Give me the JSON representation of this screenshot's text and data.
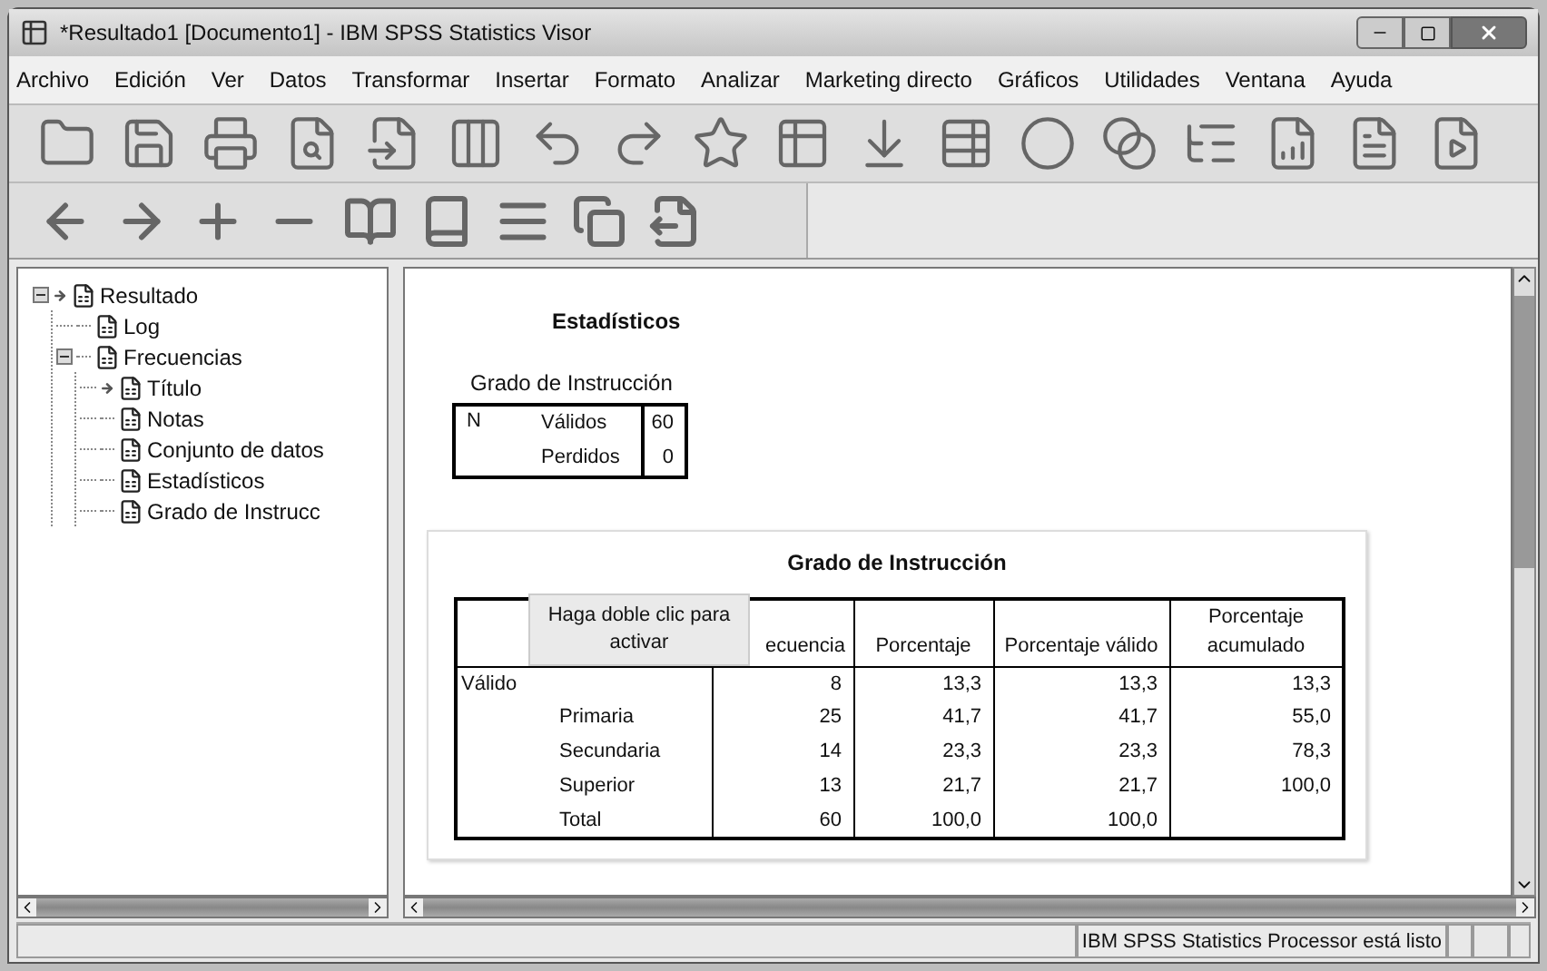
{
  "window": {
    "title": "*Resultado1 [Documento1] - IBM SPSS Statistics Visor"
  },
  "menu": [
    "Archivo",
    "Edición",
    "Ver",
    "Datos",
    "Transformar",
    "Insertar",
    "Formato",
    "Analizar",
    "Marketing directo",
    "Gráficos",
    "Utilidades",
    "Ventana",
    "Ayuda"
  ],
  "outline": [
    {
      "label": "Resultado",
      "expanded": true,
      "current": true,
      "children": [
        {
          "label": "Log",
          "current": false
        },
        {
          "label": "Frecuencias",
          "expanded": true,
          "current": false,
          "children": [
            {
              "label": "Título",
              "current": true
            },
            {
              "label": "Notas",
              "current": false
            },
            {
              "label": "Conjunto de datos",
              "current": false
            },
            {
              "label": "Estadísticos",
              "current": false
            },
            {
              "label": "Grado de Instrucc",
              "current": false
            }
          ]
        }
      ]
    }
  ],
  "statistics": {
    "title": "Estadísticos",
    "caption": "Grado de Instrucción",
    "rows": [
      [
        "N",
        "Válidos",
        "60"
      ],
      [
        "",
        "Perdidos",
        "0"
      ]
    ]
  },
  "frequency_table": {
    "title": "Grado de Instrucción",
    "columns": [
      "ecuencia",
      "Porcentaje",
      "Porcentaje válido",
      "Porcentaje acumulado"
    ],
    "rows": [
      {
        "group": "Válido",
        "cells": [
          "8",
          "13,3",
          "13,3",
          "13,3"
        ]
      },
      {
        "label": "Primaria",
        "cells": [
          "25",
          "41,7",
          "41,7",
          "55,0"
        ]
      },
      {
        "label": "Secundaria",
        "cells": [
          "14",
          "23,3",
          "23,3",
          "78,3"
        ]
      },
      {
        "label": "Superior",
        "cells": [
          "13",
          "21,7",
          "21,7",
          "100,0"
        ]
      },
      {
        "label": "Total",
        "cells": [
          "60",
          "100,0",
          "100,0"
        ]
      }
    ]
  },
  "tooltip": "Haga doble clic para activar",
  "status_bar": "IBM SPSS Statistics Processor está listo"
}
